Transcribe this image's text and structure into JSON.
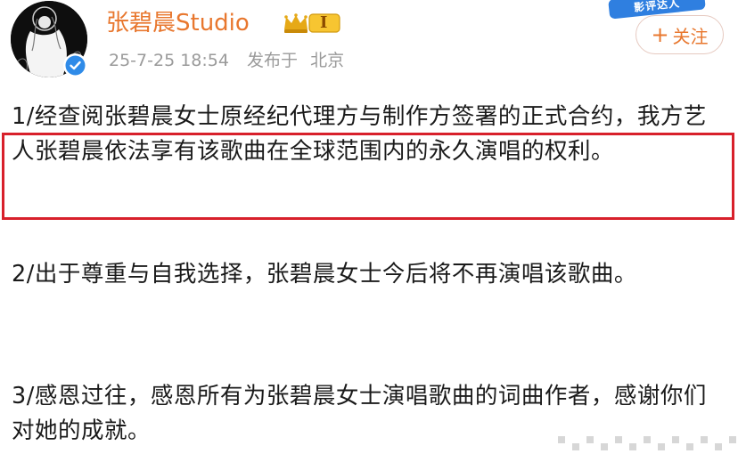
{
  "header": {
    "username": "张碧晨Studio",
    "vip_level": "I",
    "timestamp": "25-7-25 18:54",
    "published_label": "发布于",
    "location": "北京",
    "follow_label": "关注",
    "follow_plus": "+",
    "promo_badge": "影评达人"
  },
  "post": {
    "paragraphs": [
      "1/经查阅张碧晨女士原经纪代理方与制作方签署的正式合约，我方艺人张碧晨依法享有该歌曲在全球范围内的永久演唱的权利。",
      "2/出于尊重与自我选择，张碧晨女士今后将不再演唱该歌曲。",
      "3/感恩过往，感恩所有为张碧晨女士演唱歌曲的词曲作者，感谢你们对她的成就。"
    ],
    "highlight_color": "#d8202b"
  },
  "colors": {
    "username": "#e8772e",
    "meta": "#9a9a9a",
    "verified": "#2f8be8",
    "vip_gold": "#e6a917"
  },
  "icons": {
    "avatar": "avatar-illustration",
    "verified": "verified-check-icon",
    "vip": "crown-vip-icon"
  }
}
